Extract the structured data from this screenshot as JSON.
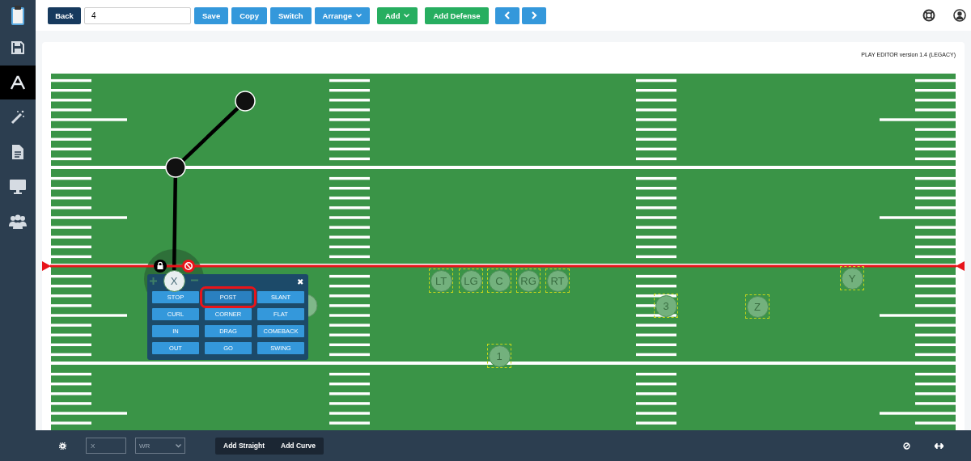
{
  "sidebar": {
    "items": [
      {
        "kind": "save",
        "selected": false
      },
      {
        "kind": "formation",
        "selected": true
      },
      {
        "kind": "wand",
        "selected": false
      },
      {
        "kind": "document",
        "selected": false
      },
      {
        "kind": "monitor",
        "selected": false
      },
      {
        "kind": "team",
        "selected": false
      }
    ]
  },
  "toolbar": {
    "back": "Back",
    "play_name": "4",
    "buttons": [
      {
        "label": "Save",
        "kind": "primary"
      },
      {
        "label": "Copy",
        "kind": "primary"
      },
      {
        "label": "Switch",
        "kind": "primary"
      },
      {
        "label": "Arrange",
        "kind": "primary_dropdown"
      },
      {
        "label": "Add",
        "kind": "success_dropdown"
      },
      {
        "label": "Add Defense",
        "kind": "success"
      }
    ],
    "nav": [
      {
        "kind": "prev"
      },
      {
        "kind": "next"
      }
    ]
  },
  "editor": {
    "version_label": "PLAY EDITOR version 1.4 (LEGACY)",
    "players": [
      {
        "label": "X",
        "selected": true
      },
      {
        "label": "LT",
        "selected": false
      },
      {
        "label": "LG",
        "selected": false
      },
      {
        "label": "C",
        "selected": false
      },
      {
        "label": "RG",
        "selected": false
      },
      {
        "label": "RT",
        "selected": false
      },
      {
        "label": "Y",
        "selected": false
      },
      {
        "label": "3",
        "selected": false
      },
      {
        "label": "Z",
        "selected": false
      },
      {
        "label": "1",
        "selected": false
      }
    ],
    "route_menu": {
      "close": "✖",
      "routes": [
        {
          "label": "STOP",
          "selected": false
        },
        {
          "label": "POST",
          "selected": true
        },
        {
          "label": "SLANT",
          "selected": false
        },
        {
          "label": "CURL",
          "selected": false
        },
        {
          "label": "CORNER",
          "selected": false
        },
        {
          "label": "FLAT",
          "selected": false
        },
        {
          "label": "IN",
          "selected": false
        },
        {
          "label": "DRAG",
          "selected": false
        },
        {
          "label": "COMEBACK",
          "selected": false
        },
        {
          "label": "OUT",
          "selected": false
        },
        {
          "label": "GO",
          "selected": false
        },
        {
          "label": "SWING",
          "selected": false
        }
      ]
    }
  },
  "bottom_bar": {
    "player_label": "X",
    "position": "WR",
    "buttons": [
      "Add Straight",
      "Add Curve"
    ]
  }
}
